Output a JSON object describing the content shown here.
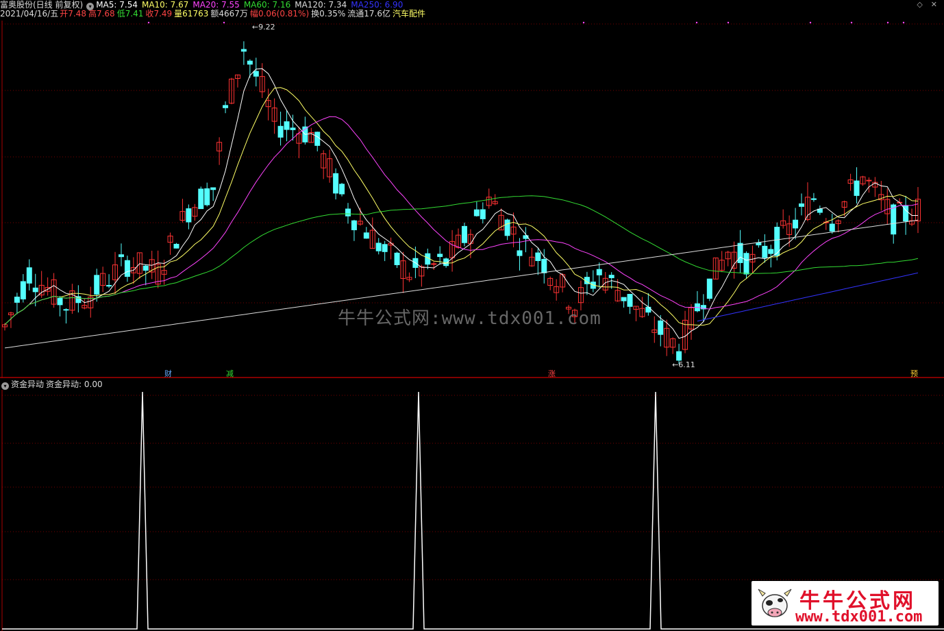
{
  "header": {
    "stock": "富奥股份(日线 前复权)",
    "ma_values": [
      {
        "label": "MA5: 7.54",
        "color": "#ffffff"
      },
      {
        "label": "MA10: 7.67",
        "color": "#ffff66"
      },
      {
        "label": "MA20: 7.55",
        "color": "#ff44ff"
      },
      {
        "label": "MA60: 7.16",
        "color": "#33dd33"
      },
      {
        "label": "MA120: 7.34",
        "color": "#dddddd"
      },
      {
        "label": "MA250: 6.90",
        "color": "#3333ff"
      }
    ]
  },
  "info": {
    "date": "2021/04/16/五",
    "open_label": "开",
    "open": "7.48",
    "high_label": "高",
    "high": "7.68",
    "low_label": "低",
    "low": "7.41",
    "close_label": "收",
    "close": "7.49",
    "vol_label": "量",
    "vol": "61763",
    "amt_label": "额",
    "amt": "4667万",
    "chg_label": "幅",
    "chg": "0.06(0.81%)",
    "turn_label": "换",
    "turn": "0.35%",
    "float_label": "流通",
    "float": "17.6亿",
    "sector": "汽车配件"
  },
  "annotations": {
    "high_mark": "9.22",
    "low_mark": "6.11"
  },
  "signals": [
    {
      "label": "财",
      "color": "#66aaff",
      "pos": "left"
    },
    {
      "label": "减",
      "color": "#33dd33",
      "pos": "left"
    },
    {
      "label": "涨",
      "color": "#ff4444",
      "pos": "middle"
    },
    {
      "label": "预",
      "color": "#ffcc33",
      "pos": "right"
    }
  ],
  "indicator": {
    "name": "资金异动",
    "label": "资金异动: 0.00",
    "spike_count": 3
  },
  "watermark": {
    "center": "牛牛公式网:www.tdx001.com",
    "logo_title": "牛牛公式网",
    "logo_url": "www.tdx001.com"
  },
  "colors": {
    "up": "#ff3333",
    "down": "#54ffff",
    "grid": "#7a0000",
    "divider": "#aa0000"
  },
  "window_icons": [
    "chevron-icon",
    "close-icon"
  ],
  "chart_data": {
    "type": "candlestick",
    "title": "富奥股份(日线 前复权)",
    "price_range": [
      6.11,
      9.22
    ],
    "moving_averages": [
      "MA5",
      "MA10",
      "MA20",
      "MA60",
      "MA120",
      "MA250"
    ],
    "last": {
      "open": 7.48,
      "high": 7.68,
      "low": 7.41,
      "close": 7.49
    },
    "indicator_series": {
      "name": "资金异动",
      "value": 0.0,
      "spikes": 3
    }
  }
}
